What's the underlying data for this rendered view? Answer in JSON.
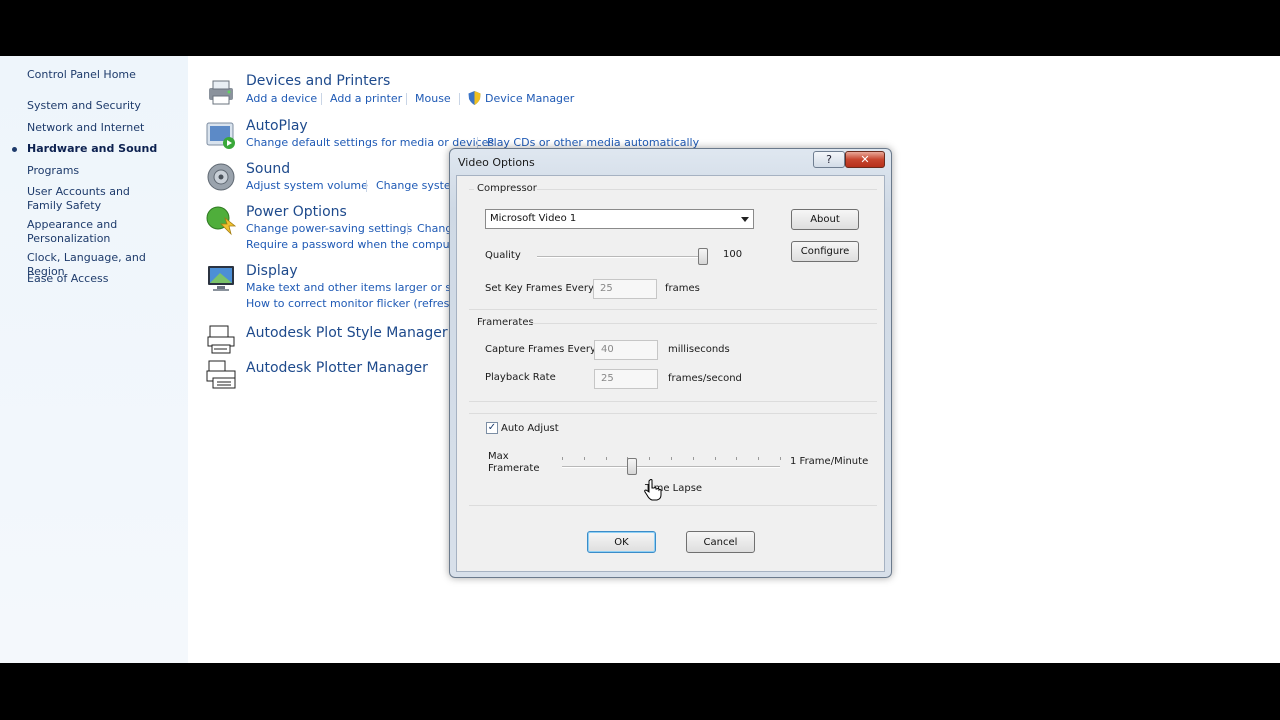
{
  "nav": {
    "items": [
      {
        "label": "Control Panel Home"
      },
      {
        "label": "System and Security"
      },
      {
        "label": "Network and Internet"
      },
      {
        "label": "Hardware and Sound",
        "active": true
      },
      {
        "label": "Programs"
      },
      {
        "label": "User Accounts and Family Safety"
      },
      {
        "label": "Appearance and Personalization"
      },
      {
        "label": "Clock, Language, and Region"
      },
      {
        "label": "Ease of Access"
      }
    ]
  },
  "categories": {
    "devices": {
      "title": "Devices and Printers",
      "links": [
        "Add a device",
        "Add a printer",
        "Mouse",
        "Device Manager"
      ]
    },
    "autoplay": {
      "title": "AutoPlay",
      "links": [
        "Change default settings for media or devices",
        "Play CDs or other media automatically"
      ]
    },
    "sound": {
      "title": "Sound",
      "links": [
        "Adjust system volume",
        "Change system"
      ]
    },
    "power": {
      "title": "Power Options",
      "links": [
        "Change power-saving settings",
        "Chang",
        "Require a password when the computer w"
      ]
    },
    "display": {
      "title": "Display",
      "links": [
        "Make text and other items larger or small",
        "How to correct monitor flicker (refresh ra"
      ]
    },
    "plot_style": {
      "title": "Autodesk Plot Style Manager"
    },
    "plotter": {
      "title": "Autodesk Plotter Manager"
    }
  },
  "dialog": {
    "title": "Video Options",
    "help_label": "?",
    "close_label": "✕",
    "compressor": {
      "group_label": "Compressor",
      "selected": "Microsoft Video 1",
      "about_label": "About",
      "configure_label": "Configure",
      "quality_label": "Quality",
      "quality_value": "100",
      "quality_fraction": 1.0,
      "keyframes_label": "Set Key Frames Every",
      "keyframes_value": "25",
      "keyframes_unit": "frames"
    },
    "framerates": {
      "group_label": "Framerates",
      "capture_label": "Capture Frames Every",
      "capture_value": "40",
      "capture_unit": "milliseconds",
      "playback_label": "Playback Rate",
      "playback_value": "25",
      "playback_unit": "frames/second"
    },
    "auto_adjust": {
      "checkbox_label": "Auto Adjust",
      "checked": true,
      "max_label_1": "Max",
      "max_label_2": "Framerate",
      "max_right_label": "1 Frame/Minute",
      "time_lapse_label": "Time Lapse",
      "slider_fraction": 0.32
    },
    "ok_label": "OK",
    "cancel_label": "Cancel"
  },
  "colors": {
    "link": "#1f5ab5",
    "title_link": "#1e4a8c",
    "nav_text": "#1e3b6b"
  }
}
